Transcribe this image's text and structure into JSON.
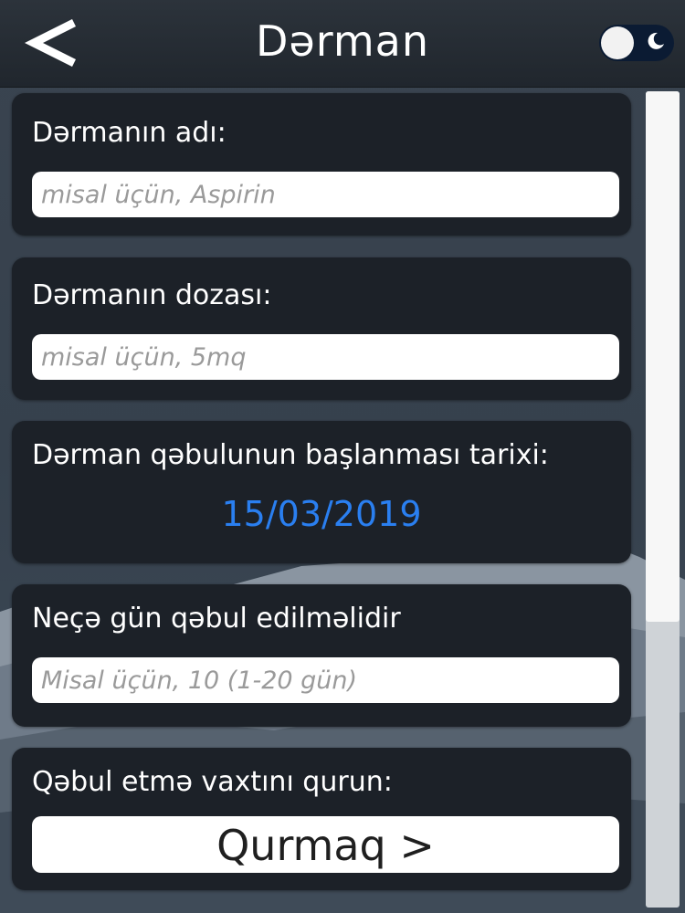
{
  "header": {
    "title": "Dərman",
    "back_icon": "chevron-left-icon",
    "theme_toggle": {
      "state": "off",
      "icon": "moon-icon"
    }
  },
  "fields": {
    "name": {
      "label": "Dərmanın adı:",
      "placeholder": "misal üçün, Aspirin",
      "value": ""
    },
    "dose": {
      "label": "Dərmanın dozası:",
      "placeholder": "misal üçün, 5mq",
      "value": ""
    },
    "start_date": {
      "label": "Dərman qəbulunun başlanması tarixi:",
      "value": "15/03/2019"
    },
    "days": {
      "label": "Neçə gün qəbul edilməlidir",
      "placeholder": "Misal üçün, 10 (1-20 gün)",
      "value": ""
    },
    "schedule": {
      "label": "Qəbul etmə vaxtını qurun:",
      "button_label": "Qurmaq >"
    }
  },
  "scroll": {
    "thumb_fraction": 0.65,
    "position": 0
  },
  "colors": {
    "header_bg": "#23292f",
    "card_bg": "#1c2128",
    "date_accent": "#2a7ff0",
    "toggle_bg": "#0b1b33"
  }
}
